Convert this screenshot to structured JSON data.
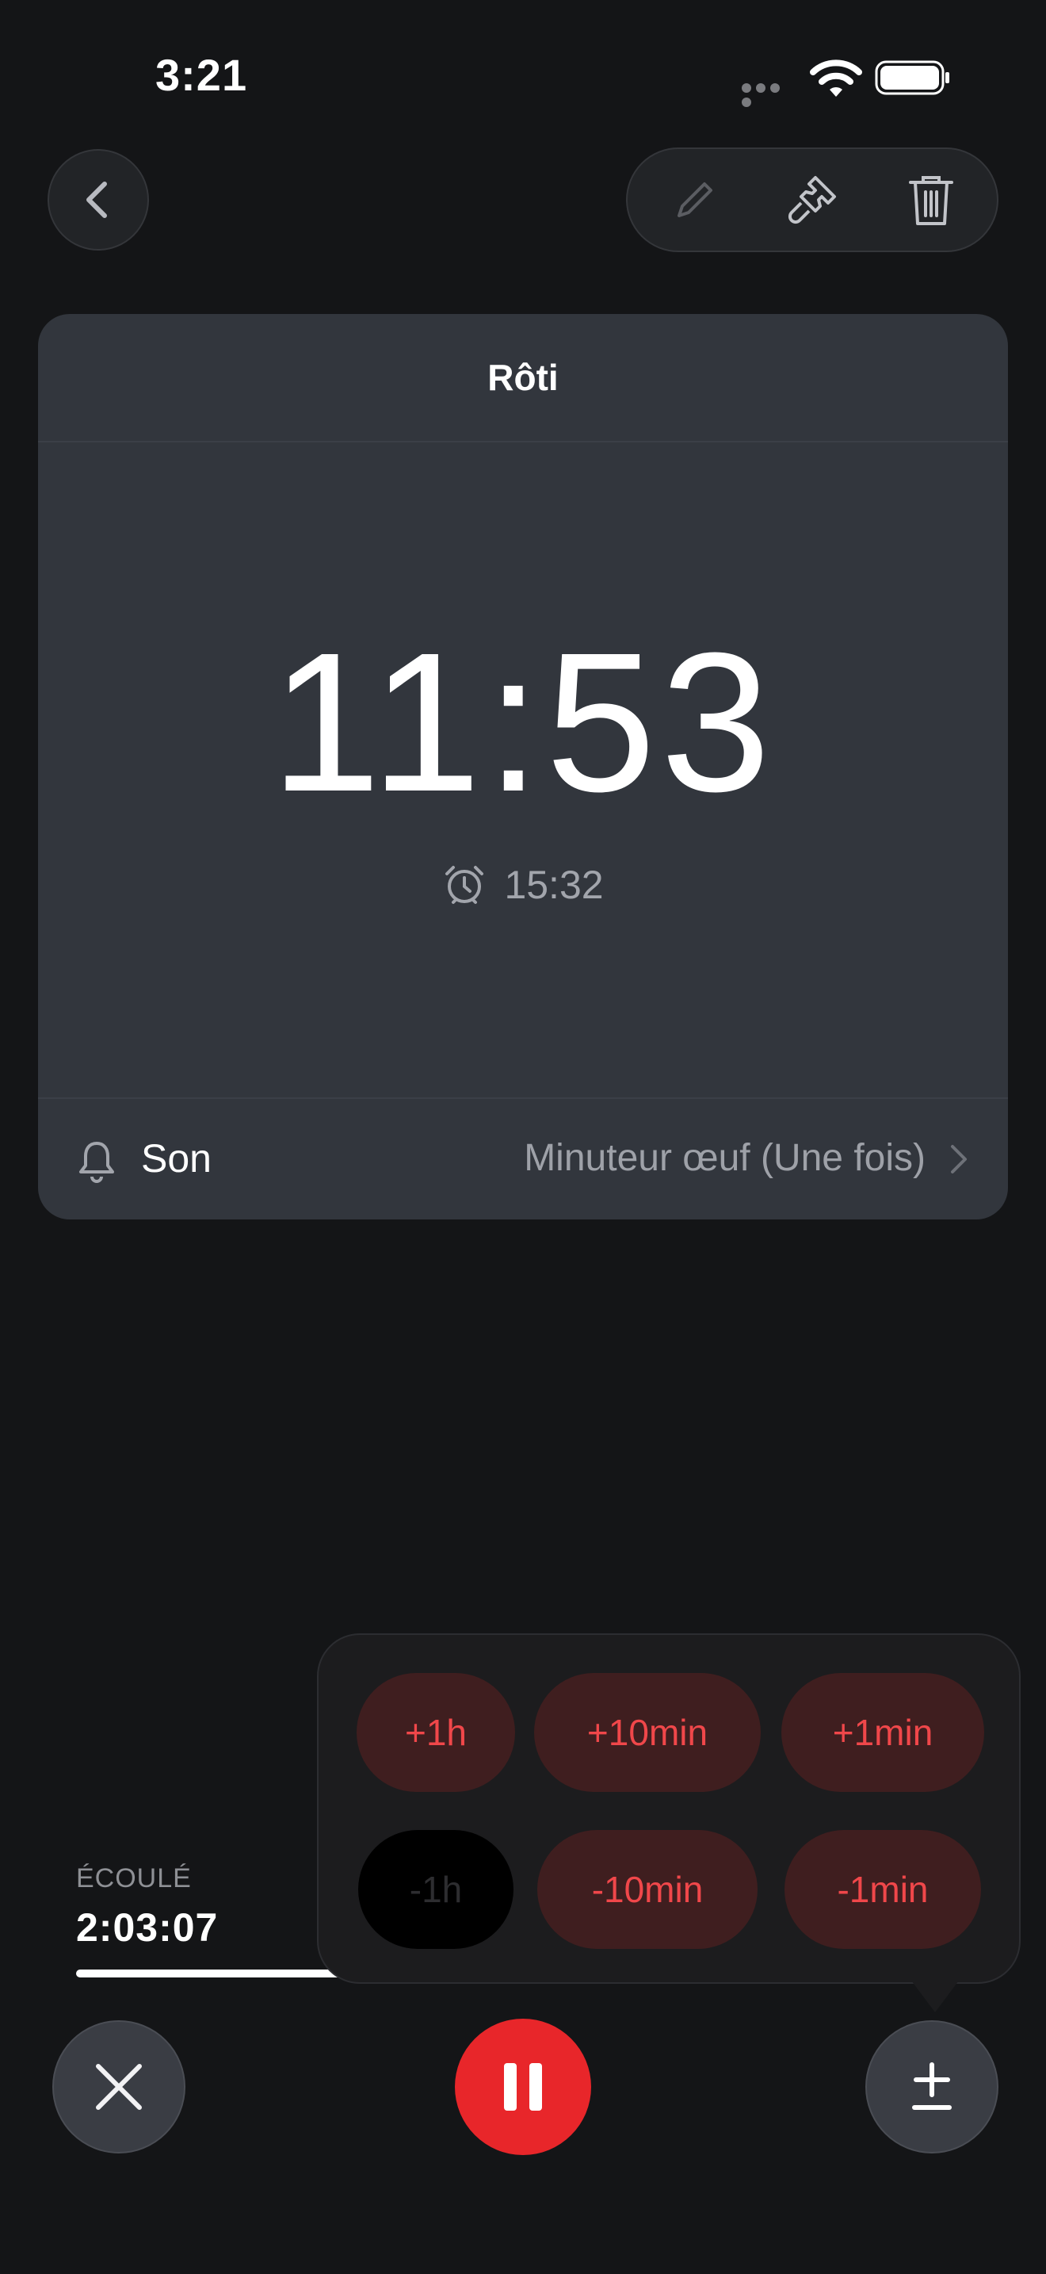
{
  "status_bar": {
    "time": "3:21"
  },
  "card": {
    "title": "Rôti",
    "remaining": "11:53",
    "end_time": "15:32",
    "sound_label": "Son",
    "sound_value": "Minuteur œuf (Une fois)"
  },
  "adjust": {
    "add": [
      "+1h",
      "+10min",
      "+1min"
    ],
    "subtract": [
      "-1h",
      "-10min",
      "-1min"
    ]
  },
  "elapsed": {
    "label": "ÉCOULÉ",
    "value": "2:03:07",
    "progress": 0.37
  },
  "colors": {
    "accent": "#e8262a",
    "chip_bg": "#3f1e1f",
    "chip_text": "#f0474a"
  },
  "icons": [
    "chevron-left-icon",
    "pencil-icon",
    "brush-icon",
    "trash-icon",
    "alarm-clock-icon",
    "bell-icon",
    "chevron-right-icon",
    "close-icon",
    "pause-icon",
    "plus-minus-icon"
  ]
}
